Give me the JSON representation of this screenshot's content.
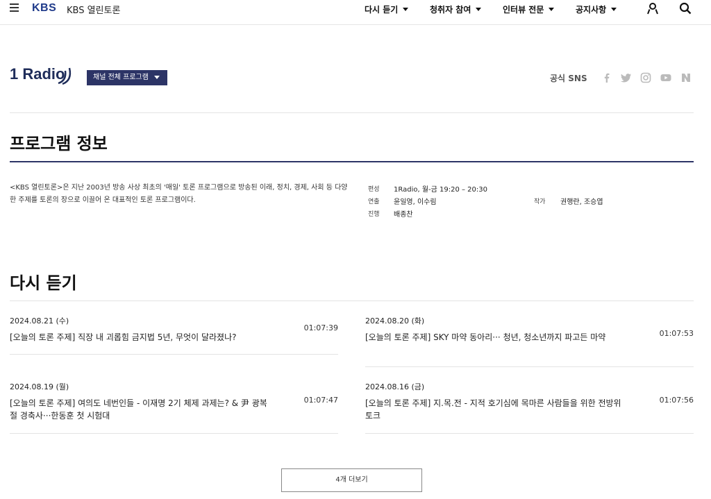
{
  "header": {
    "logo": "KBS",
    "site_name": "KBS 열린토론",
    "nav": [
      {
        "label": "다시 듣기"
      },
      {
        "label": "청취자 참여"
      },
      {
        "label": "인터뷰 전문"
      },
      {
        "label": "공지사항"
      }
    ],
    "icons": [
      "menu-icon",
      "user-icon",
      "search-icon"
    ]
  },
  "channel": {
    "logo_text": "1 Radio",
    "dropdown_label": "채널 전체 프로그램",
    "sns_label": "공식 SNS",
    "sns_icons": [
      "facebook-icon",
      "twitter-icon",
      "instagram-icon",
      "youtube-icon",
      "naver-icon"
    ]
  },
  "program_info": {
    "title": "프로그램 정보",
    "description": "<KBS 열린토론>은 지난 2003년 방송 사상 최초의 '매일' 토론 프로그램으로 방송된 이래, 정치, 경제, 사회 등 다양한 주제를 토론의 장으로 이끌어 온 대표적인 토론 프로그램이다.",
    "schedule_label": "편성",
    "schedule_value": "1Radio, 월-금 19:20 – 20:30",
    "director_label": "연출",
    "director_value": "윤일영, 이수림",
    "writer_label": "작가",
    "writer_value": "권행란, 조승엽",
    "host_label": "진행",
    "host_value": "배종찬"
  },
  "replay": {
    "title": "다시 듣기",
    "episodes": [
      {
        "date": "2024.08.21 (수)",
        "title": "[오늘의 토론 주제] 직장 내 괴롭힘 금지법 5년, 무엇이 달라졌나?",
        "duration": "01:07:39"
      },
      {
        "date": "2024.08.20 (화)",
        "title": "[오늘의 토론 주제] SKY 마약 동아리··· 청년, 청소년까지 파고든 마약",
        "duration": "01:07:53"
      },
      {
        "date": "2024.08.19 (월)",
        "title": "[오늘의 토론 주제] 여의도 네번인들 - 이재명 2기 체제 과제는? & 尹 광복절 경축사···한동훈 첫 시험대",
        "duration": "01:07:47"
      },
      {
        "date": "2024.08.16 (금)",
        "title": "[오늘의 토론 주제] 지.목.전 - 지적 호기심에 목마른 사람들을 위한 전방위 토크",
        "duration": "01:07:56"
      }
    ],
    "more_label": "4개 더보기"
  },
  "colors": {
    "brand": "#1f3a8a",
    "navy": "#2c3466"
  }
}
